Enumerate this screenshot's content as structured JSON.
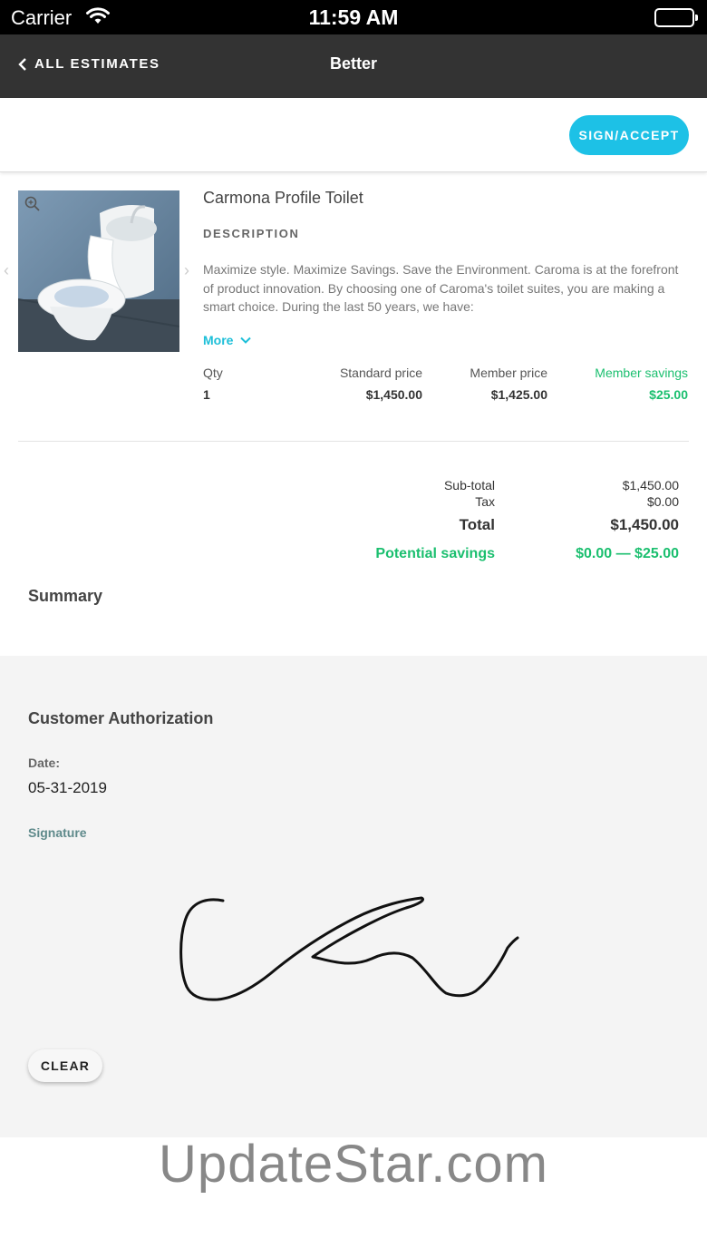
{
  "status_bar": {
    "carrier": "Carrier",
    "time": "11:59 AM"
  },
  "nav": {
    "back_label": "ALL ESTIMATES",
    "title": "Better"
  },
  "actions": {
    "sign_accept_label": "SIGN/ACCEPT"
  },
  "product": {
    "title": "Carmona Profile Toilet",
    "description_heading": "DESCRIPTION",
    "description": "Maximize style. Maximize Savings. Save the Environment. Caroma is at the forefront of product innovation. By choosing one of Caroma's toilet suites, you are making a smart choice. During the last 50 years, we have:",
    "more_label": "More"
  },
  "pricing": {
    "qty_label": "Qty",
    "qty_value": "1",
    "standard_label": "Standard price",
    "standard_value": "$1,450.00",
    "member_label": "Member price",
    "member_value": "$1,425.00",
    "savings_label": "Member savings",
    "savings_value": "$25.00"
  },
  "totals": {
    "subtotal_label": "Sub-total",
    "subtotal_value": "$1,450.00",
    "tax_label": "Tax",
    "tax_value": "$0.00",
    "total_label": "Total",
    "total_value": "$1,450.00",
    "potential_label": "Potential savings",
    "potential_value": "$0.00 — $25.00"
  },
  "summary_label": "Summary",
  "authorization": {
    "title": "Customer Authorization",
    "date_label": "Date:",
    "date_value": "05-31-2019",
    "signature_label": "Signature",
    "clear_label": "CLEAR"
  },
  "watermark": "UpdateStar.com",
  "colors": {
    "accent": "#1dc1e6",
    "savings_green": "#1bbf6f",
    "nav_bg": "#333333",
    "link": "#1dbfd8"
  }
}
